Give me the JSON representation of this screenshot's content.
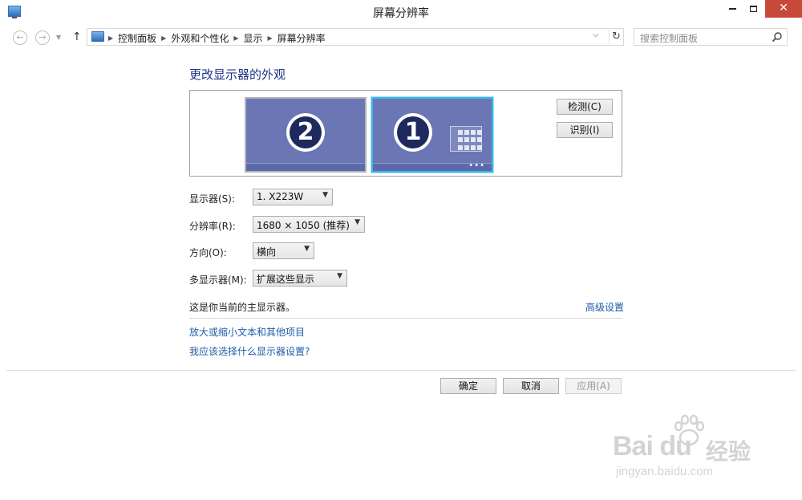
{
  "window": {
    "title": "屏幕分辨率",
    "minimize_label": "",
    "maximize_label": "",
    "close_label": "✕"
  },
  "nav": {
    "back_glyph": "←",
    "forward_glyph": "→",
    "up_glyph": "↑",
    "breadcrumb": [
      "控制面板",
      "外观和个性化",
      "显示",
      "屏幕分辨率"
    ],
    "refresh_glyph": "↻",
    "search_placeholder": "搜索控制面板"
  },
  "main": {
    "heading": "更改显示器的外观",
    "monitors": [
      {
        "number": "2"
      },
      {
        "number": "1"
      }
    ],
    "detect_button": "检测(C)",
    "identify_button": "识别(I)",
    "fields": {
      "display_label": "显示器(S):",
      "display_value": "1. X223W",
      "resolution_label": "分辨率(R):",
      "resolution_value": "1680 × 1050 (推荐)",
      "orientation_label": "方向(O):",
      "orientation_value": "横向",
      "multi_label": "多显示器(M):",
      "multi_value": "扩展这些显示"
    },
    "primary_note": "这是你当前的主显示器。",
    "advanced_link": "高级设置",
    "links": {
      "enlarge_text": "放大或缩小文本和其他项目",
      "which_settings": "我应该选择什么显示器设置?"
    }
  },
  "footer": {
    "ok_button": "确定",
    "cancel_button": "取消",
    "apply_button": "应用(A)"
  },
  "watermark": {
    "brand": "Bai du",
    "brand_cn": "经验",
    "url": "jingyan.baidu.com"
  }
}
